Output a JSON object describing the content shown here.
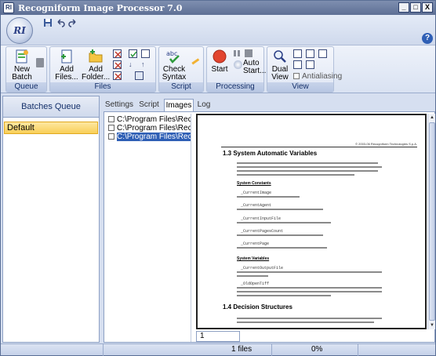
{
  "window": {
    "title": "Recogniform Image Processor 7.0",
    "icon_label": "RI",
    "minimize": "_",
    "maximize": "□",
    "close": "X"
  },
  "orb": {
    "label": "RI"
  },
  "quick_access": {
    "save_icon": "save-icon",
    "undo_icon": "undo-icon",
    "redo_icon": "redo-icon"
  },
  "help_label": "?",
  "ribbon": {
    "groups": {
      "queue": "Queue",
      "files": "Files",
      "script": "Script",
      "processing": "Processing",
      "view": "View"
    },
    "new_batch": "New Batch",
    "add_files": "Add Files...",
    "add_folder": "Add Folder...",
    "check_syntax": "Check Syntax",
    "start": "Start",
    "auto_start": "Auto Start...",
    "dual_view": "Dual View",
    "antialiasing": "Antialiasing"
  },
  "left_panel": {
    "header": "Batches  Queue",
    "items": [
      "Default"
    ]
  },
  "tabs": [
    "Settings",
    "Script",
    "Images",
    "Log"
  ],
  "active_tab": "Images",
  "files": [
    "C:\\Program Files\\Recognit",
    "C:\\Program Files\\Recognit",
    "C:\\Program Files\\Recognit"
  ],
  "preview": {
    "header_right": "© 2003-06 Recogniform Technologies S.p.A.",
    "section_1_3": "1.3     System Automatic Variables",
    "system_constants": "System Constants",
    "system_variables": "System Variables",
    "section_1_4": "1.4     Decision Structures",
    "mono_items": [
      "_CurrentImage",
      "_CurrentAgent",
      "_CurrentInputFile",
      "_CurrentPagesCount",
      "_CurrentPage",
      "_CurrentOutputFile",
      "_OldOpenTiff"
    ]
  },
  "page_field": "1",
  "status": {
    "files_count": "1 files",
    "progress": "0%"
  },
  "colors": {
    "title_bar": "#5d6f95",
    "ribbon": "#dfe6f4",
    "selected_item": "#f9cf58",
    "selected_file": "#2f5fb5"
  }
}
